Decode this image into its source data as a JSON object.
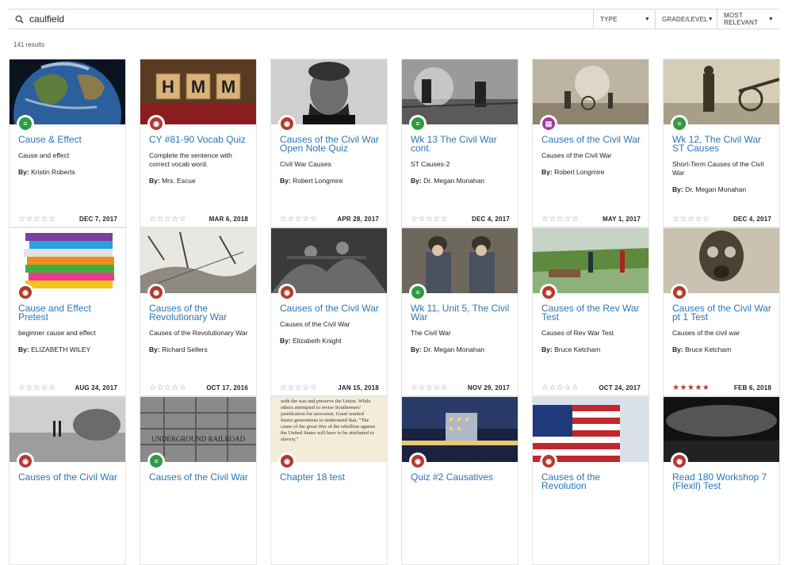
{
  "search": {
    "value": "caulfield",
    "placeholder": ""
  },
  "filters": {
    "type": "TYPE",
    "grade": "GRADE/LEVEL",
    "sort": "MOST RELEVANT"
  },
  "results_count": "141 results",
  "colors": {
    "link": "#2b74b6",
    "quiz": "#b23a2e",
    "lesson": "#2e9a44",
    "doc": "#9b3ba0"
  },
  "cards": [
    {
      "title": "Cause & Effect",
      "desc": "Cause and effect",
      "by": "By:",
      "author": "Kristin Roberts",
      "date": "DEC 7, 2017",
      "rating": 0,
      "kind": "lesson",
      "icon": "lesson-icon"
    },
    {
      "title": "CY #81-90 Vocab Quiz",
      "desc": "Complete the sentence with correct vocab word.",
      "by": "By:",
      "author": "Mrs. Escue",
      "date": "MAR 6, 2018",
      "rating": 0,
      "kind": "quiz",
      "icon": "quiz-icon"
    },
    {
      "title": "Causes of the Civil War Open Note Quiz",
      "desc": "Civil War Causes",
      "by": "By:",
      "author": "Robert Longmire",
      "date": "APR 28, 2017",
      "rating": 0,
      "kind": "quiz",
      "icon": "quiz-icon"
    },
    {
      "title": "Wk 13 The Civil War cont.",
      "desc": "ST Causes-2",
      "by": "By:",
      "author": "Dr. Megan Monahan",
      "date": "DEC 4, 2017",
      "rating": 0,
      "kind": "lesson",
      "icon": "lesson-icon"
    },
    {
      "title": "Causes of the Civil War",
      "desc": "Causes of the Civil War",
      "by": "By:",
      "author": "Robert Longmire",
      "date": "MAY 1, 2017",
      "rating": 0,
      "kind": "doc",
      "icon": "document-icon"
    },
    {
      "title": "Wk 12, The Civil War ST Causes",
      "desc": "Short-Term Causes of the Civil War",
      "by": "By:",
      "author": "Dr. Megan Monahan",
      "date": "DEC 4, 2017",
      "rating": 0,
      "kind": "lesson",
      "icon": "lesson-icon"
    },
    {
      "title": "Cause and Effect Pretest",
      "desc": "beginner cause and effect",
      "by": "By:",
      "author": "ELIZABETH WILEY",
      "date": "AUG 24, 2017",
      "rating": 0,
      "kind": "quiz",
      "icon": "quiz-icon"
    },
    {
      "title": "Causes of the Revolutionary War",
      "desc": "Causes of the Revolutionary War",
      "by": "By:",
      "author": "Richard Sellers",
      "date": "OCT 17, 2016",
      "rating": 0,
      "kind": "quiz",
      "icon": "quiz-icon"
    },
    {
      "title": "Causes of the Civil War",
      "desc": "Causes of the Civil War",
      "by": "By:",
      "author": "Elizabeth Knight",
      "date": "JAN 15, 2018",
      "rating": 0,
      "kind": "quiz",
      "icon": "quiz-icon"
    },
    {
      "title": "Wk 11, Unit 5, The Civil War",
      "desc": "The Civil War",
      "by": "By:",
      "author": "Dr. Megan Monahan",
      "date": "NOV 29, 2017",
      "rating": 0,
      "kind": "lesson",
      "icon": "lesson-icon"
    },
    {
      "title": "Causes of the Rev War Test",
      "desc": "Causes of Rev War Test",
      "by": "By:",
      "author": "Bruce Ketcham",
      "date": "OCT 24, 2017",
      "rating": 0,
      "kind": "quiz",
      "icon": "quiz-icon"
    },
    {
      "title": "Causes of the Civil War pt 1 Test",
      "desc": "Causes of the civil war",
      "by": "By:",
      "author": "Bruce Ketcham",
      "date": "FEB 6, 2018",
      "rating": 5,
      "kind": "quiz",
      "icon": "quiz-icon"
    },
    {
      "title": "Causes of the Civil War",
      "desc": "",
      "by": "",
      "author": "",
      "date": "",
      "rating": 0,
      "kind": "quiz",
      "icon": "quiz-icon"
    },
    {
      "title": "Causes of the Civil War",
      "desc": "",
      "by": "",
      "author": "",
      "date": "",
      "rating": 0,
      "kind": "lesson",
      "icon": "lesson-icon"
    },
    {
      "title": "Chapter 18 test",
      "desc": "",
      "by": "",
      "author": "",
      "date": "",
      "rating": 0,
      "kind": "quiz",
      "icon": "quiz-icon"
    },
    {
      "title": "Quiz #2 Causatives",
      "desc": "",
      "by": "",
      "author": "",
      "date": "",
      "rating": 0,
      "kind": "quiz",
      "icon": "quiz-icon"
    },
    {
      "title": "Causes of the Revolution",
      "desc": "",
      "by": "",
      "author": "",
      "date": "",
      "rating": 0,
      "kind": "quiz",
      "icon": "quiz-icon"
    },
    {
      "title": "Read 180 Workshop 7 (Flexll) Test",
      "desc": "",
      "by": "",
      "author": "",
      "date": "",
      "rating": 0,
      "kind": "quiz",
      "icon": "quiz-icon"
    }
  ],
  "thumb_texts": {
    "hmm": [
      "H",
      "M",
      "M"
    ],
    "underground": "UNDERGROUND RAILROAD",
    "chapter_text": "with the war and preserve the Union. While others attempted to revise Southerners' justification for secession, Grant wanted future generations to understand that, \"The cause of the great War of the rebellion against the United States will have to be attributed to slavery.\""
  }
}
